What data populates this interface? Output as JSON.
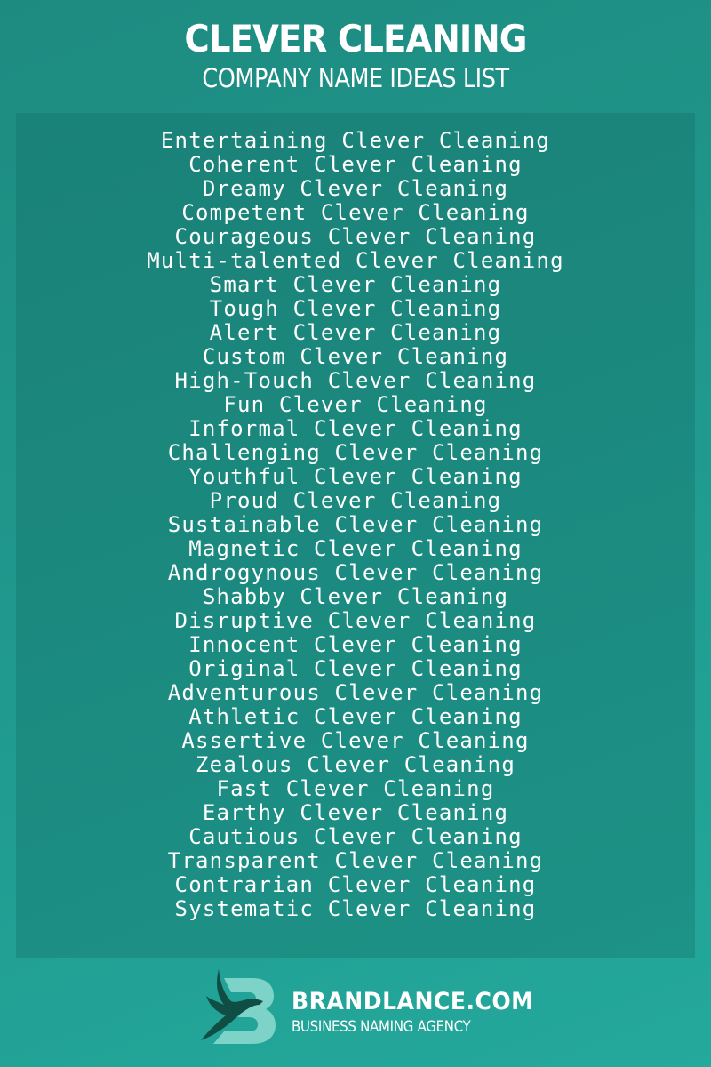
{
  "header": {
    "title": "CLEVER CLEANING",
    "subtitle": "COMPANY NAME IDEAS LIST"
  },
  "names": [
    "Entertaining Clever Cleaning",
    "Coherent Clever Cleaning",
    "Dreamy Clever Cleaning",
    "Competent Clever Cleaning",
    "Courageous Clever Cleaning",
    "Multi-talented Clever Cleaning",
    "Smart Clever Cleaning",
    "Tough Clever Cleaning",
    "Alert Clever Cleaning",
    "Custom Clever Cleaning",
    "High-Touch Clever Cleaning",
    "Fun Clever Cleaning",
    "Informal Clever Cleaning",
    "Challenging Clever Cleaning",
    "Youthful Clever Cleaning",
    "Proud Clever Cleaning",
    "Sustainable Clever Cleaning",
    "Magnetic Clever Cleaning",
    "Androgynous Clever Cleaning",
    "Shabby Clever Cleaning",
    "Disruptive Clever Cleaning",
    "Innocent Clever Cleaning",
    "Original Clever Cleaning",
    "Adventurous Clever Cleaning",
    "Athletic Clever Cleaning",
    "Assertive Clever Cleaning",
    "Zealous Clever Cleaning",
    "Fast Clever Cleaning",
    "Earthy Clever Cleaning",
    "Cautious Clever Cleaning",
    "Transparent Clever Cleaning",
    "Contrarian Clever Cleaning",
    "Systematic Clever Cleaning"
  ],
  "footer": {
    "logo_icon": "brandlance-bird-b-logo",
    "brand": "BRANDLANCE.COM",
    "tagline": "BUSINESS NAMING AGENCY"
  },
  "colors": {
    "background_top": "#1e8b80",
    "background_bottom": "#24a99c",
    "text": "#ffffff",
    "logo_light": "#7dd3c8",
    "logo_dark": "#0f4d45"
  }
}
